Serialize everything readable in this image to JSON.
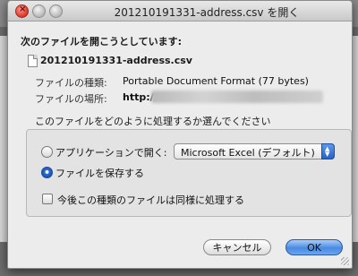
{
  "window": {
    "title": "201210191331-address.csv を開く"
  },
  "dialog": {
    "heading": "次のファイルを開こうとしています:",
    "filename": "201210191331-address.csv",
    "kind_label": "ファイルの種類:",
    "kind_value": "Portable Document Format (77 bytes)",
    "location_label": "ファイルの場所:",
    "location_value": "http://",
    "question": "このファイルをどのように処理するか選んでください"
  },
  "options": {
    "open_with_label": "アプリケーションで開く:",
    "open_with_app": "Microsoft Excel (デフォルト)",
    "save_label": "ファイルを保存する",
    "selected": "save",
    "remember_label": "今後この種類のファイルは同様に処理する",
    "remember_checked": false
  },
  "buttons": {
    "cancel": "キャンセル",
    "ok": "OK"
  },
  "icons": {
    "close": "close-icon",
    "file": "file-icon",
    "select_arrows": "up-down-arrows-icon"
  },
  "colors": {
    "accent": "#2f6fd0",
    "dialog_bg": "#ececec"
  }
}
